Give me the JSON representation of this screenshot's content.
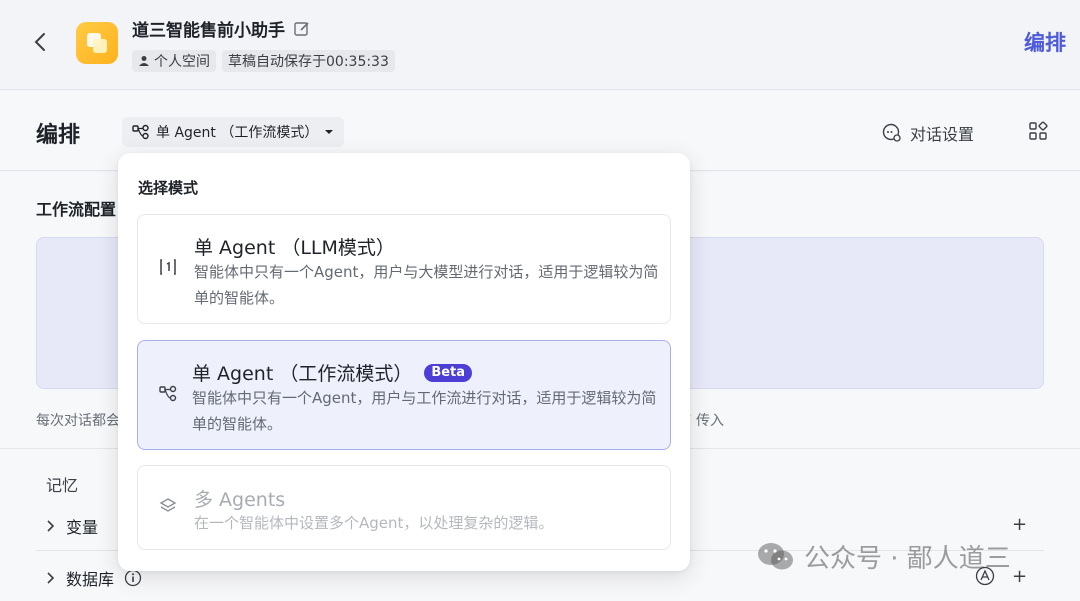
{
  "header": {
    "title": "道三智能售前小助手",
    "space_label": "个人空间",
    "autosave_label": "草稿自动保存于00:35:33",
    "right_action": "编排"
  },
  "toolbar": {
    "title": "编排",
    "mode_label": "单 Agent （工作流模式）",
    "dialog_settings": "对话设置"
  },
  "background": {
    "section_title": "工作流配置",
    "note_left": "每次对话都会",
    "note_right": "T” 传入",
    "memory_label": "记忆",
    "rows": [
      {
        "label": "变量"
      },
      {
        "label": "数据库"
      }
    ],
    "plus": "+"
  },
  "popup": {
    "title": "选择模式",
    "options": [
      {
        "name": "单 Agent （LLM模式）",
        "desc": "智能体中只有一个Agent，用户与大模型进行对话，适用于逻辑较为简单的智能体。",
        "icon": "llm-mode-icon"
      },
      {
        "name": "单 Agent （工作流模式）",
        "badge": "Beta",
        "desc": "智能体中只有一个Agent，用户与工作流进行对话，适用于逻辑较为简单的智能体。",
        "icon": "workflow-mode-icon"
      },
      {
        "name": "多 Agents",
        "desc": "在一个智能体中设置多个Agent，以处理复杂的逻辑。",
        "icon": "multi-agents-icon"
      }
    ]
  },
  "watermark": {
    "text": "公众号 · 鄙人道三"
  },
  "colors": {
    "accent": "#4d5bdb",
    "beta": "#4d3fd6",
    "selected_bg": "#eef0fc"
  }
}
